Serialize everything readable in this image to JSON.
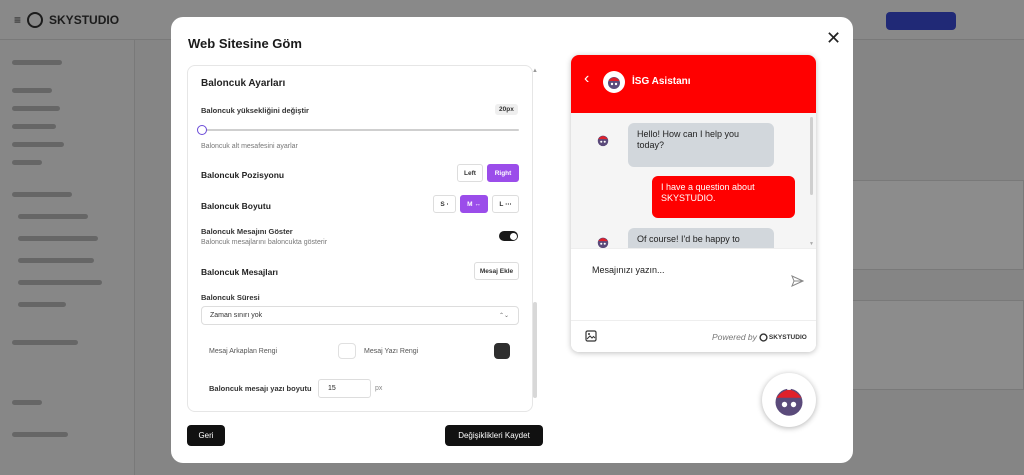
{
  "modal": {
    "title": "Web Sitesine Göm",
    "close_icon": "close-icon",
    "back_label": "Geri",
    "save_label": "Değişiklikleri Kaydet"
  },
  "settings": {
    "section_title": "Baloncuk Ayarları",
    "height": {
      "label": "Baloncuk yüksekliğini değiştir",
      "value_badge": "20px",
      "slider_fraction": 0.0,
      "description": "Baloncuk alt mesafesini ayarlar"
    },
    "position": {
      "label": "Baloncuk Pozisyonu",
      "options": [
        "Left",
        "Right"
      ],
      "selected": "Right"
    },
    "size": {
      "label": "Baloncuk Boyutu",
      "options": [
        "S ⋅",
        "M ↔",
        "L ⋯"
      ],
      "selected": "M ↔"
    },
    "show_message": {
      "label": "Baloncuk Mesajını Göster",
      "description": "Baloncuk mesajlarını baloncukta gösterir",
      "enabled": true
    },
    "messages": {
      "label": "Baloncuk Mesajları",
      "add_button": "Mesaj Ekle"
    },
    "duration": {
      "label": "Baloncuk Süresi",
      "selected": "Zaman sınırı yok"
    },
    "colors": {
      "bg_label": "Mesaj Arkaplan Rengi",
      "bg_color": "#ffffff",
      "text_label": "Mesaj Yazı Rengi",
      "text_color": "#2e2e2e"
    },
    "font_size": {
      "label": "Baloncuk mesajı yazı boyutu",
      "value": "15",
      "unit": "px"
    }
  },
  "chat": {
    "title": "İSG Asistanı",
    "accent": "#ff0000",
    "messages": [
      {
        "from": "bot",
        "text": "Hello! How can I help you today?"
      },
      {
        "from": "user",
        "text": "I have a question about SKYSTUDIO."
      },
      {
        "from": "bot",
        "text": "Of course! I'd be happy to"
      }
    ],
    "input_placeholder": "Mesajınızı yazın...",
    "powered_by": "Powered by",
    "brand": "SKYSTUDIO"
  }
}
